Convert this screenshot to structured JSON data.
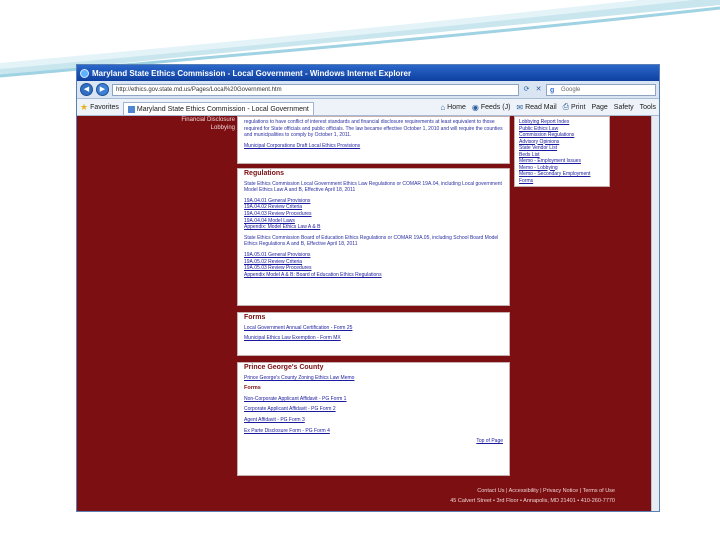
{
  "window": {
    "title": "Maryland State Ethics Commission - Local Government - Windows Internet Explorer"
  },
  "address": {
    "url": "http://ethics.gov.state.md.us/Pages/Local%20Government.htm",
    "search_placeholder": "Google"
  },
  "toolbar": {
    "favorites": "Favorites",
    "tab_title": "Maryland State Ethics Commission - Local Government",
    "home": "Home",
    "feeds": "Feeds (J)",
    "read_mail": "Read Mail",
    "print": "Print",
    "page": "Page",
    "safety": "Safety",
    "tools": "Tools"
  },
  "left_nav": [
    "Financial Disclosure",
    "Lobbying"
  ],
  "intro": {
    "text": "regulations to have conflict of interest standards and financial disclosure requirements at least equivalent to those required for State officials and public officials. The law became effective October 1, 2010 and will require the counties and municipalities to comply by October 1, 2011.",
    "link": "Municipal Corporations Draft Local Ethics Provisions"
  },
  "regulations": {
    "heading": "Regulations",
    "intro": "State Ethics Commission Local Government Ethics Law Regulations or COMAR 19A.04, including Local government Model Ethics Law A and B, Effective April 18, 2011",
    "items1": [
      "19A.04.01 General Provisions",
      "19A.04.02 Review Criteria",
      "19A.04.03 Review Procedures",
      "19A.04.04 Model Laws",
      "Appendix: Model Ethics Law A & B"
    ],
    "intro2": "State Ethics Commission Board of Education Ethics Regulations or COMAR 19A.05, including School Board Model Ethics Regulations A and B, Effective April 18, 2011",
    "items2": [
      "19A.05.01 General Provisions",
      "19A.05.02 Review Criteria",
      "19A.05.03 Review Procedures",
      "Appendix Model A & B: Board of Education Ethics Regulations"
    ]
  },
  "forms": {
    "heading": "Forms",
    "items": [
      "Local Government Annual Certification - Form 25",
      "Municipal Ethics Law Exemption - Form MX"
    ]
  },
  "pg_county": {
    "heading": "Prince George's County",
    "link": "Prince George's County Zoning Ethics Law Memo",
    "subheading": "Forms",
    "items": [
      "Non-Corporate Applicant Affidavit - PG Form 1",
      "Corporate Applicant Affidavit - PG Form 2",
      "Agent Affidavit - PG Form 3",
      "Ex Parte Disclosure Form - PG Form 4"
    ],
    "top": "Top of Page"
  },
  "right_links": [
    "Lobbying Report Index",
    "Public Ethics Law",
    "Commission Regulations",
    "Advisory Opinions",
    "State Vendor List",
    "Beds List",
    "Memo - Employment Issues",
    "Memo - Lobbying",
    "Memo - Secondary Employment",
    "Forms"
  ],
  "footer": {
    "links": "Contact Us  |  Accessibility  |  Privacy Notice  |  Terms of Use",
    "address": "45 Calvert Street • 3rd Floor • Annapolis, MD 21401 • 410-260-7770"
  }
}
